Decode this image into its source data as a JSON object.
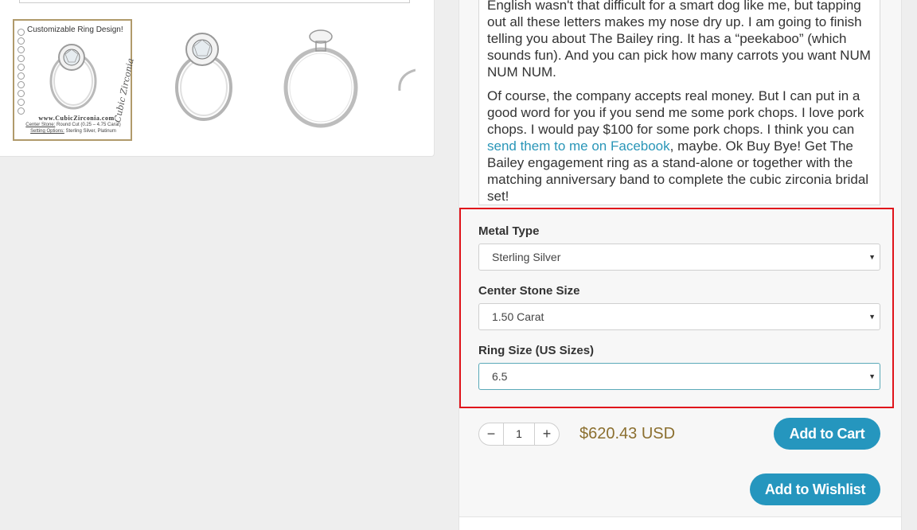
{
  "gallery": {
    "thumb_caption": "Customizable Ring Design!",
    "thumb_site": "www.CubicZirconia.com",
    "thumb_center_stone_label": "Center Stone:",
    "thumb_center_stone_value": "Round Cut (0.25 – 4.75 Carat)",
    "thumb_setting_label": "Setting Options:",
    "thumb_setting_value": "Sterling Silver, Platinum",
    "thumb_signature": "Cubic Zirconia"
  },
  "description": {
    "para1": "English wasn't that difficult for a smart dog like me, but tapping out all these letters makes my nose dry up. I am going to finish telling you about The Bailey ring. It has a “peekaboo” (which sounds fun). And you can pick how many carrots you want NUM NUM NUM.",
    "para2_before": "Of course, the company accepts real money. But I can put in a good word for you if you send me some pork chops. I love pork chops. I would pay $100 for some pork chops. I think you can ",
    "para2_link": "send them to me on Facebook",
    "para2_after": ", maybe. Ok Buy Bye! Get The Bailey engagement ring as a stand-alone or together with the matching anniversary band to complete the cubic zirconia bridal set!"
  },
  "options": {
    "metal_type": {
      "label": "Metal Type",
      "value": "Sterling Silver"
    },
    "center_stone": {
      "label": "Center Stone Size",
      "value": "1.50 Carat"
    },
    "ring_size": {
      "label": "Ring Size (US Sizes)",
      "value": "6.5"
    }
  },
  "purchase": {
    "minus": "−",
    "quantity": "1",
    "plus": "+",
    "price": "$620.43 USD",
    "add_to_cart": "Add to Cart",
    "add_to_wishlist": "Add to Wishlist"
  },
  "colors": {
    "accent": "#2596be",
    "price": "#8b6f2f",
    "highlight_border": "#e0141b"
  }
}
